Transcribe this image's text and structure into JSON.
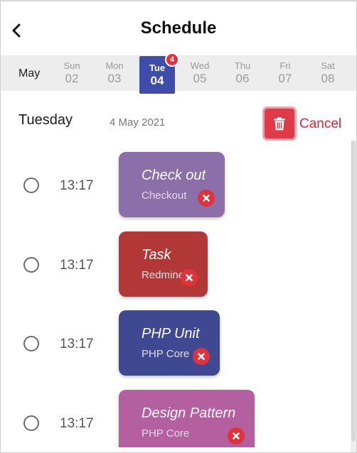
{
  "header": {
    "title": "Schedule",
    "back_icon": "chevron-left-icon"
  },
  "week": {
    "month": "May",
    "days": [
      {
        "name": "Sun",
        "date": "02"
      },
      {
        "name": "Mon",
        "date": "03"
      },
      {
        "name": "Tue",
        "date": "04",
        "selected": true,
        "badge": "4"
      },
      {
        "name": "Wed",
        "date": "05"
      },
      {
        "name": "Thu",
        "date": "06"
      },
      {
        "name": "Fri",
        "date": "07"
      },
      {
        "name": "Sat",
        "date": "08"
      }
    ]
  },
  "selected_day": {
    "day_name": "Tuesday",
    "full_date": "4 May 2021"
  },
  "actions": {
    "delete_icon": "trash-icon",
    "cancel_label": "Cancel"
  },
  "events": [
    {
      "time": "13:17",
      "title": "Check out",
      "subtitle": "Checkout",
      "color": "#8c6fa8"
    },
    {
      "time": "13:17",
      "title": "Task",
      "subtitle": "Redmine",
      "color": "#b23838"
    },
    {
      "time": "13:17",
      "title": "PHP Unit",
      "subtitle": "PHP Core",
      "color": "#3f4992"
    },
    {
      "time": "13:17",
      "title": "Design Pattern",
      "subtitle": "PHP Core",
      "color": "#b35fa0"
    }
  ],
  "colors": {
    "accent": "#3e4ea8",
    "danger": "#e0323b",
    "cancel": "#d7263d"
  }
}
